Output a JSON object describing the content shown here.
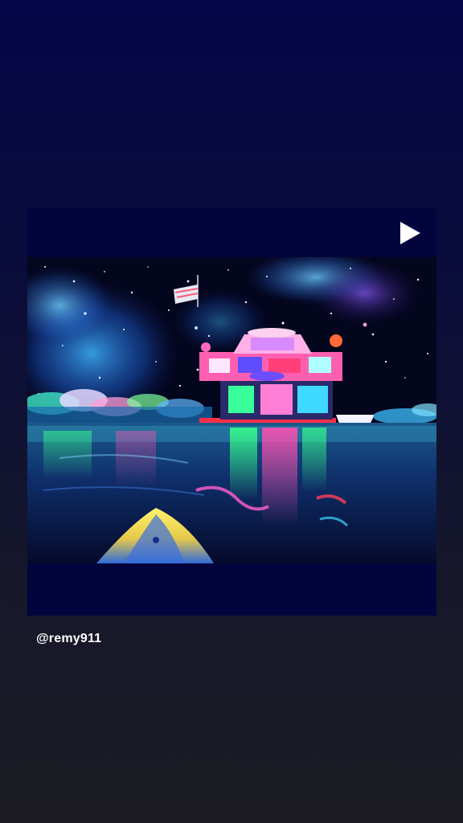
{
  "story": {
    "media_description": "",
    "play_icon": "play-icon",
    "username": "@remy911"
  }
}
